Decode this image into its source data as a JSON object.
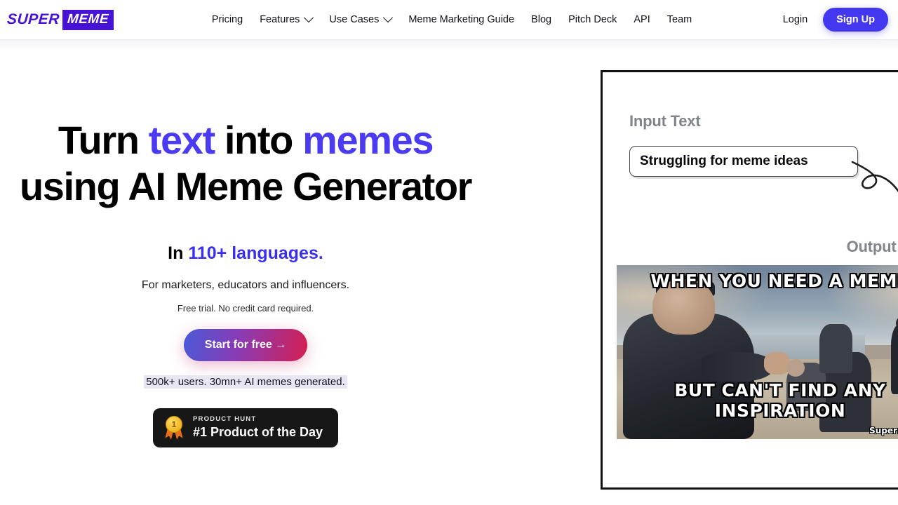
{
  "brand": {
    "logo_primary": "SUPER",
    "logo_secondary": "MEME",
    "logo_color": "#4612d6"
  },
  "nav": {
    "items": [
      {
        "label": "Pricing",
        "has_dropdown": false
      },
      {
        "label": "Features",
        "has_dropdown": true
      },
      {
        "label": "Use Cases",
        "has_dropdown": true
      },
      {
        "label": "Meme Marketing Guide",
        "has_dropdown": false
      },
      {
        "label": "Blog",
        "has_dropdown": false
      },
      {
        "label": "Pitch Deck",
        "has_dropdown": false
      },
      {
        "label": "API",
        "has_dropdown": false
      },
      {
        "label": "Team",
        "has_dropdown": false
      }
    ],
    "login_label": "Login",
    "signup_label": "Sign Up",
    "signup_color": "#4338f0"
  },
  "hero": {
    "headline_part1": "Turn ",
    "headline_accent1": "text",
    "headline_part2": " into ",
    "headline_accent2": "memes",
    "headline_part3": " using AI Meme Generator",
    "accent_color": "#4a3af2",
    "languages_prefix": "In ",
    "languages_accent": "110+ languages.",
    "audience": "For marketers, educators and influencers.",
    "trial_note": "Free trial. No credit card required.",
    "cta_label": "Start for free →",
    "stats": "500k+ users. 30mn+ AI memes generated.",
    "product_hunt": {
      "kicker": "PRODUCT HUNT",
      "title": "#1 Product of the Day",
      "medal_rank": "1"
    }
  },
  "demo_panel": {
    "input_label": "Input Text",
    "input_value": "Struggling for meme ideas",
    "output_label": "Output Meme",
    "meme": {
      "top_text": "WHEN YOU NEED A MEME",
      "bottom_text": "BUT CAN'T FIND ANY INSPIRATION",
      "watermark": "Supermeme.ai"
    }
  }
}
